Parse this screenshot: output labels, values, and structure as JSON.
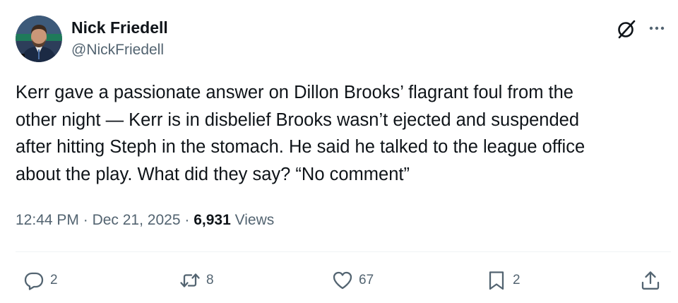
{
  "author": {
    "name": "Nick Friedell",
    "handle": "@NickFriedell"
  },
  "icons": {
    "grok": "grok-icon",
    "more": "more-options-icon",
    "reply": "reply-icon",
    "repost": "repost-icon",
    "like": "heart-icon",
    "bookmark": "bookmark-icon",
    "share": "share-icon"
  },
  "tweet": {
    "text": "Kerr gave a passionate answer on Dillon Brooks’ flagrant foul from the\nother night — Kerr is in disbelief Brooks wasn’t ejected and suspended\nafter hitting Steph in the stomach. He said he talked to the league office\nabout the play. What did they say? “No comment”",
    "time": "12:44 PM",
    "separator": "·",
    "date": "Dec 21, 2025",
    "views_count": "6,931",
    "views_label": "Views"
  },
  "actions": {
    "reply_count": "2",
    "repost_count": "8",
    "like_count": "67",
    "bookmark_count": "2"
  },
  "colors": {
    "text_primary": "#0f1419",
    "text_secondary": "#536471",
    "divider": "#eff3f4"
  }
}
